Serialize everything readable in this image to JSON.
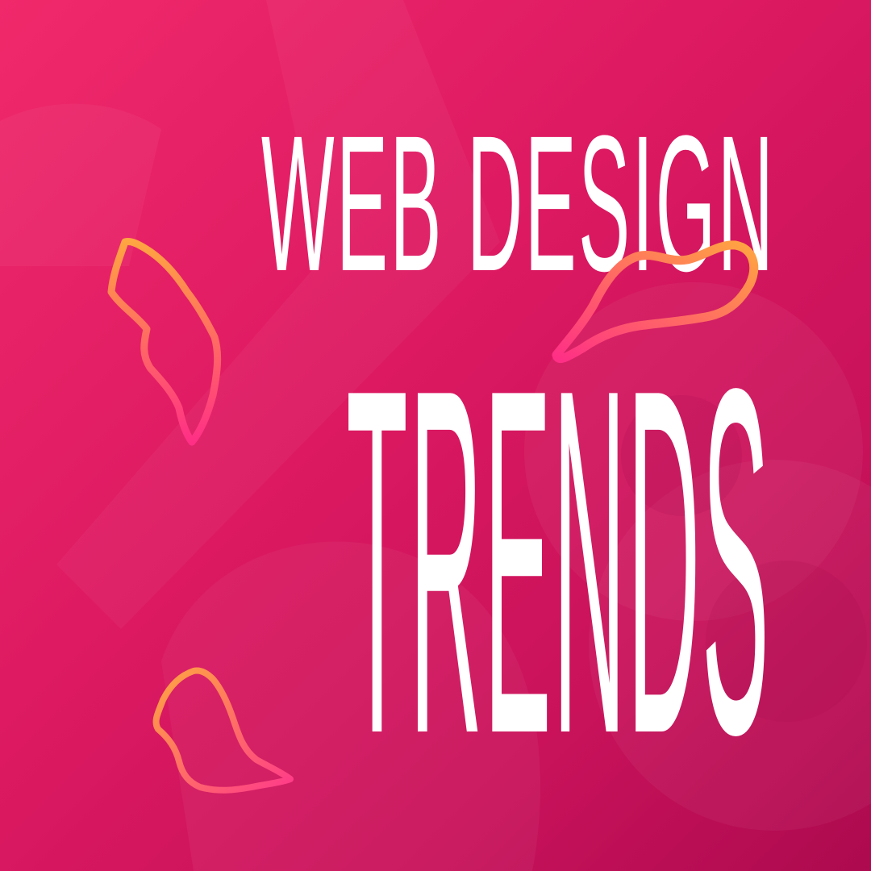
{
  "poster": {
    "title_line1": "WEB DESIGN",
    "title_line2": "TRENDS"
  },
  "colors": {
    "background_start": "#f0296b",
    "background_end": "#ad0a4f",
    "text": "#ffffff",
    "ribbon_orange": "#ffa541",
    "ribbon_pink": "#ff3a8a"
  }
}
